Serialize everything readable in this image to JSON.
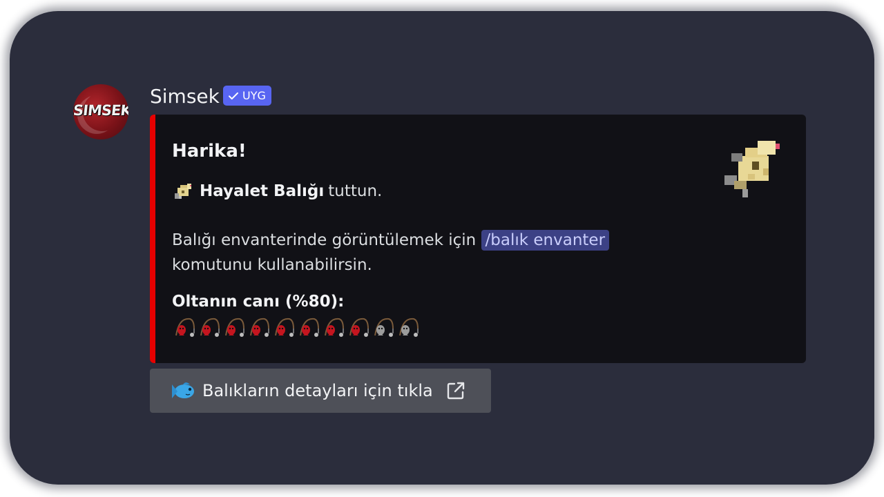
{
  "message": {
    "author": "Simsek",
    "avatar_text": "SIMSEK",
    "badge": {
      "label": "UYG",
      "icon": "check-icon",
      "color": "#5865f2"
    }
  },
  "embed": {
    "accent_color": "#e60000",
    "title": "Harika!",
    "caught_fish_name": "Hayalet Balığı",
    "caught_suffix": "tuttun.",
    "inventory_text_before": "Balığı envanterinde görüntülemek için",
    "inventory_command": "/balık envanter",
    "inventory_text_after": "komutunu kullanabilirsin.",
    "durability_label": "Oltanın canı (%80):",
    "durability_fraction": 0.8,
    "durability_rods": [
      {
        "state": "full",
        "icon": "red-rod-icon"
      },
      {
        "state": "full",
        "icon": "red-rod-icon"
      },
      {
        "state": "full",
        "icon": "red-rod-icon"
      },
      {
        "state": "full",
        "icon": "red-rod-icon"
      },
      {
        "state": "full",
        "icon": "red-rod-icon"
      },
      {
        "state": "full",
        "icon": "red-rod-icon"
      },
      {
        "state": "full",
        "icon": "red-rod-icon"
      },
      {
        "state": "full",
        "icon": "red-rod-icon"
      },
      {
        "state": "empty",
        "icon": "gray-rod-icon"
      },
      {
        "state": "empty",
        "icon": "gray-rod-icon"
      }
    ],
    "thumbnail_icon": "ghost-fish-icon"
  },
  "button": {
    "label": "Balıkların detayları için tıkla",
    "emoji": "fish-icon",
    "trailing_icon": "external-link-icon"
  },
  "colors": {
    "background": "#2b2d3c",
    "embed_background": "#111116",
    "button_background": "#4e5058",
    "command_background": "#3c4185"
  }
}
